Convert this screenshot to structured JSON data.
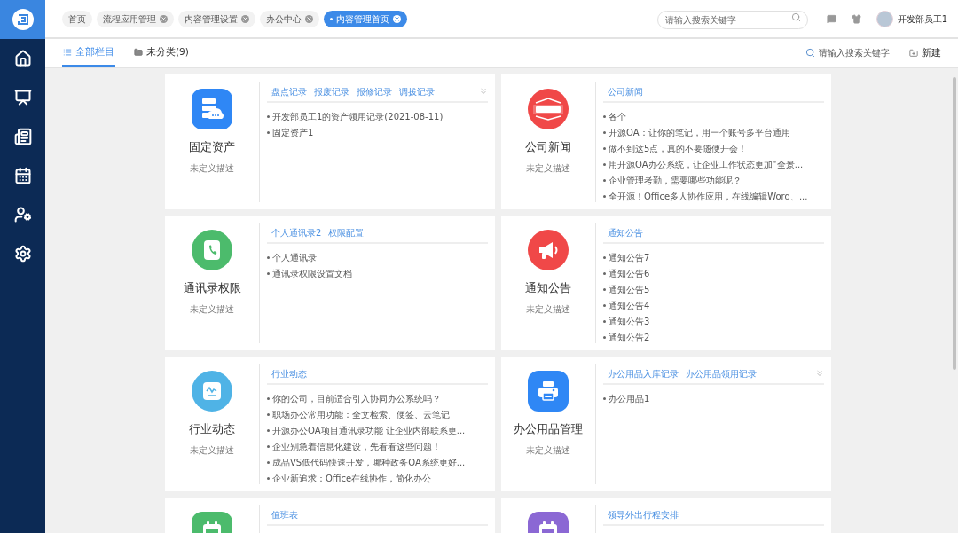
{
  "top_tabs": [
    {
      "label": "首页",
      "closable": false,
      "selected": false
    },
    {
      "label": "流程应用管理",
      "closable": true,
      "selected": false
    },
    {
      "label": "内容管理设置",
      "closable": true,
      "selected": false
    },
    {
      "label": "办公中心",
      "closable": true,
      "selected": false
    },
    {
      "label": "内容管理首页",
      "closable": true,
      "selected": true
    }
  ],
  "header_search": {
    "placeholder": "请输入搜索关键字"
  },
  "user": {
    "name": "开发部员工1"
  },
  "sub_tabs": [
    {
      "label": "全部栏目",
      "kind": "list",
      "selected": true
    },
    {
      "label": "未分类(9)",
      "kind": "folder",
      "selected": false
    }
  ],
  "sub_search": {
    "placeholder": "请输入搜索关键字"
  },
  "new_button": "新建",
  "cards": [
    {
      "kind": "assets",
      "color": "#2f87f5",
      "title": "固定资产",
      "description": "未定义描述",
      "links": [
        "盘点记录",
        "报废记录",
        "报修记录",
        "调拨记录"
      ],
      "expandable": true,
      "items": [
        "开发部员工1的资产领用记录(2021-08-11)",
        "固定资产1"
      ]
    },
    {
      "kind": "news",
      "color": "#f04848",
      "title": "公司新闻",
      "description": "未定义描述",
      "links": [
        "公司新闻"
      ],
      "expandable": false,
      "items": [
        "各个",
        "开源OA：让你的笔记，用一个账号多平台通用",
        "做不到这5点，真的不要随便开会！",
        "用开源OA办公系统，让企业工作状态更加“全景...",
        "企业管理考勤，需要哪些功能呢？",
        "全开源！Office多人协作应用，在线编辑Word、..."
      ]
    },
    {
      "kind": "phone",
      "color": "#4cbb6c",
      "title": "通讯录权限",
      "description": "未定义描述",
      "links": [
        "个人通讯录2",
        "权限配置"
      ],
      "expandable": false,
      "items": [
        "个人通讯录",
        "通讯录权限设置文档"
      ]
    },
    {
      "kind": "announce",
      "color": "#f04848",
      "title": "通知公告",
      "description": "未定义描述",
      "links": [
        "通知公告"
      ],
      "expandable": false,
      "items": [
        "通知公告7",
        "通知公告6",
        "通知公告5",
        "通知公告4",
        "通知公告3",
        "通知公告2"
      ]
    },
    {
      "kind": "trend",
      "color": "#4fb3e6",
      "title": "行业动态",
      "description": "未定义描述",
      "links": [
        "行业动态"
      ],
      "expandable": false,
      "items": [
        "你的公司，目前适合引入协同办公系统吗？",
        "职场办公常用功能：全文检索、便签、云笔记",
        "开源办公OA项目通讯录功能 让企业内部联系更...",
        "企业别急着信息化建设，先看看这些问题！",
        "成品VS低代码快速开发，哪种政务OA系统更好...",
        "企业新追求：Office在线协作，简化办公"
      ]
    },
    {
      "kind": "printer",
      "color": "#2f87f5",
      "title": "办公用品管理",
      "description": "未定义描述",
      "links": [
        "办公用品入库记录",
        "办公用品领用记录"
      ],
      "expandable": true,
      "items": [
        "办公用品1"
      ]
    },
    {
      "kind": "calendar",
      "color": "#4cbb6c",
      "links": [
        "值班表"
      ],
      "expandable": false
    },
    {
      "kind": "schedule",
      "color": "#8b68d4",
      "links": [
        "领导外出行程安排"
      ],
      "expandable": false
    }
  ]
}
